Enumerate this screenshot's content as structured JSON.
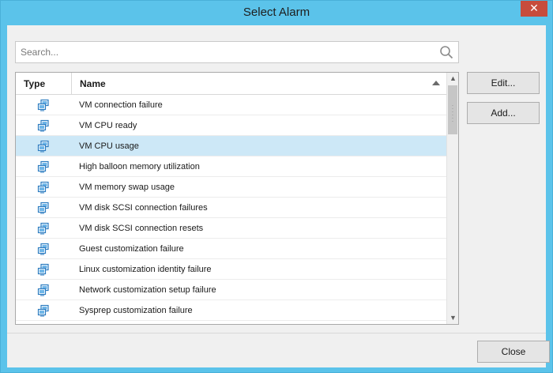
{
  "window": {
    "title": "Select Alarm",
    "close_glyph": "✕"
  },
  "search": {
    "placeholder": "Search...",
    "value": "",
    "icon": "search-icon"
  },
  "table": {
    "columns": [
      "Type",
      "Name"
    ],
    "sort_column": "Name",
    "sort_direction": "ascending",
    "row_icon": "vm-alarm-icon",
    "selected_index": 2,
    "rows": [
      "VM connection failure",
      "VM CPU ready",
      "VM CPU usage",
      "High balloon memory utilization",
      "VM memory swap usage",
      "VM disk SCSI connection failures",
      "VM disk SCSI connection resets",
      "Guest customization failure",
      "Linux customization identity failure",
      "Network customization setup failure",
      "Sysprep customization failure"
    ]
  },
  "buttons": {
    "edit": "Edit...",
    "add": "Add...",
    "close": "Close"
  },
  "colors": {
    "titlebar": "#5bc3ea",
    "selection": "#cde8f7",
    "close_button": "#c74c3c"
  }
}
